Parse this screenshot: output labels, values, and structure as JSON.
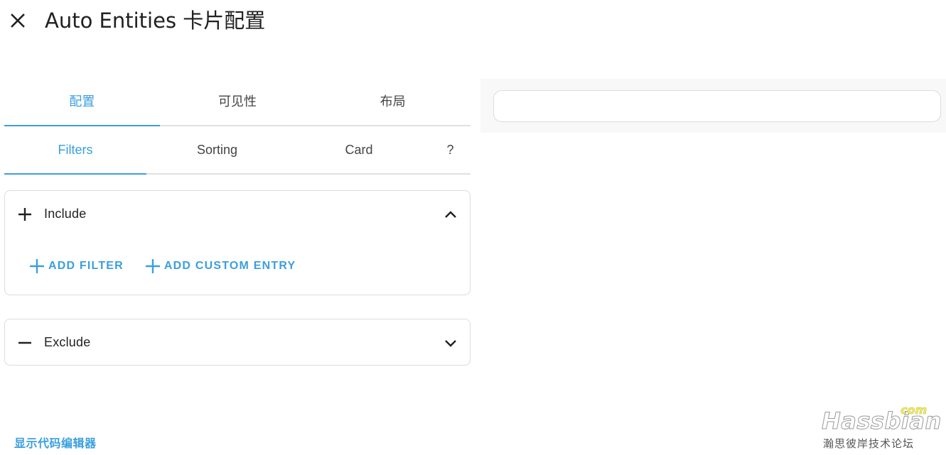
{
  "header": {
    "title": "Auto Entities 卡片配置",
    "close_icon": "close-icon"
  },
  "main_tabs": [
    {
      "label": "配置",
      "active": true
    },
    {
      "label": "可见性",
      "active": false
    },
    {
      "label": "布局",
      "active": false
    }
  ],
  "sub_tabs": [
    {
      "label": "Filters",
      "active": true
    },
    {
      "label": "Sorting",
      "active": false
    },
    {
      "label": "Card",
      "active": false
    },
    {
      "label": "?",
      "active": false
    }
  ],
  "include_panel": {
    "title": "Include",
    "icon": "plus-icon",
    "expanded": true,
    "buttons": [
      {
        "label": "ADD FILTER",
        "icon": "plus-icon"
      },
      {
        "label": "ADD CUSTOM ENTRY",
        "icon": "plus-icon"
      }
    ]
  },
  "exclude_panel": {
    "title": "Exclude",
    "icon": "minus-icon",
    "expanded": false
  },
  "footer": {
    "code_editor_link": "显示代码编辑器"
  },
  "watermark": {
    "brand": "Hassbian",
    "suffix": "com",
    "subtitle": "瀚思彼岸技术论坛"
  },
  "colors": {
    "accent": "#3b9fdd",
    "text": "#212121",
    "border": "#dcdcdc",
    "preview_bg": "#f8f8f8"
  }
}
